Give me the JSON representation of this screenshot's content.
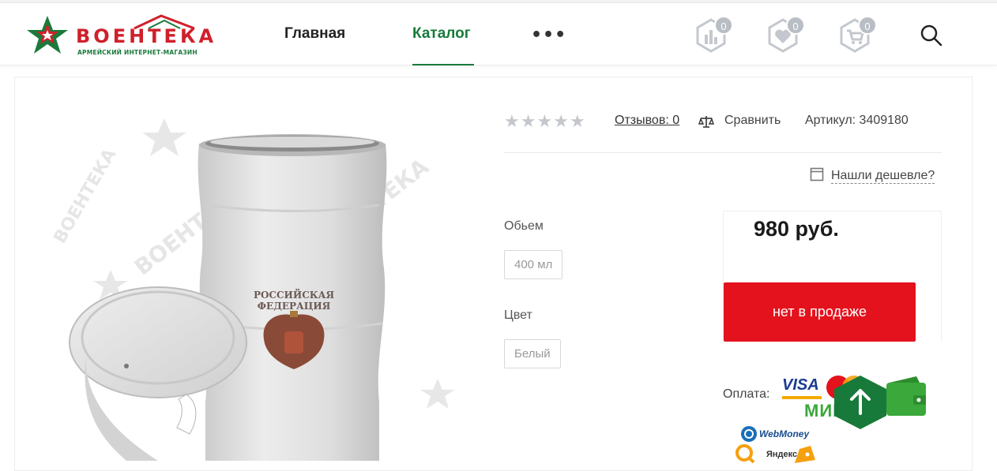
{
  "brand": {
    "name": "ВОЕНТЕКА",
    "tagline": "АРМЕЙСКИЙ ИНТЕРНЕТ-МАГАЗИН",
    "colors": {
      "red": "#d0202a",
      "green": "#177a3a"
    }
  },
  "nav": {
    "items": [
      {
        "label": "Главная",
        "active": false
      },
      {
        "label": "Каталог",
        "active": true
      }
    ],
    "more_label": "•••"
  },
  "header_icons": {
    "compare": {
      "icon": "compare-chart-icon",
      "count": "0"
    },
    "favorites": {
      "icon": "heart-icon",
      "count": "0"
    },
    "cart": {
      "icon": "cart-icon",
      "count": "0"
    },
    "search": {
      "icon": "search-icon"
    }
  },
  "product": {
    "image_alt": "Термокружка с гербом Российской Федерации",
    "mug_text_line1": "РОССИЙСКАЯ",
    "mug_text_line2": "ФЕДЕРАЦИЯ",
    "watermark": "ВОЕНТЕКА",
    "rating": 0,
    "reviews_label": "Отзывов: 0",
    "compare_label": "Сравнить",
    "article_label": "Артикул: 3409180",
    "cheaper_label": "Нашли дешевле?",
    "properties": [
      {
        "label": "Обьем",
        "value": "400 мл"
      },
      {
        "label": "Цвет",
        "value": "Белый"
      }
    ],
    "price": "980 руб.",
    "buy_label": "нет в продаже",
    "buy_color": "#e3121c"
  },
  "payment": {
    "label": "Оплата:",
    "methods": {
      "visa": "VISA",
      "mir": "МИР",
      "webmoney": "WebMoney",
      "yandex": "Яндекс"
    }
  },
  "scroll_top": {
    "icon": "arrow-up-icon",
    "color": "#177a3a"
  }
}
